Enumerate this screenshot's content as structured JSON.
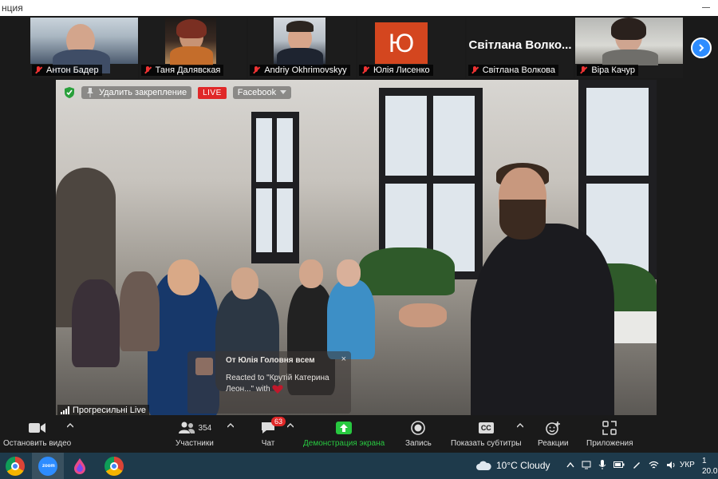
{
  "window": {
    "title": "нция"
  },
  "participants": [
    {
      "name": "Антон Бадер"
    },
    {
      "name": "Таня Далявская"
    },
    {
      "name": "Andriy Okhrimovskyy"
    },
    {
      "name": "Юлія Лисенко",
      "avatar_letter": "Ю"
    },
    {
      "name": "Світлана Волкова",
      "display_name": "Світлана  Волко..."
    },
    {
      "name": "Віра Качур"
    }
  ],
  "video": {
    "unpin_label": "Удалить закрепление",
    "live_label": "LIVE",
    "stream_target": "Facebook",
    "channel_label": "Прогресильні Live"
  },
  "reaction": {
    "from": "От Юлія Головня всем",
    "message": "Reacted to \"Крутій Катерина Леон...\" with",
    "close": "×"
  },
  "controls": {
    "stop_video": "Остановить видео",
    "participants_count": "354",
    "participants": "Участники",
    "chat_badge": "63",
    "chat": "Чат",
    "share": "Демонстрация экрана",
    "record": "Запись",
    "subtitles": "Показать субтитры",
    "subtitles_icon_text": "CC",
    "reactions": "Реакции",
    "apps": "Приложения"
  },
  "taskbar": {
    "weather": "10°C  Cloudy",
    "language": "УКР",
    "clock_top": "1",
    "clock_bottom": "20.0"
  },
  "colors": {
    "accent_blue": "#2d8cff",
    "live_red": "#e02828",
    "share_green": "#28c840",
    "avatar_orange": "#d4461f"
  }
}
